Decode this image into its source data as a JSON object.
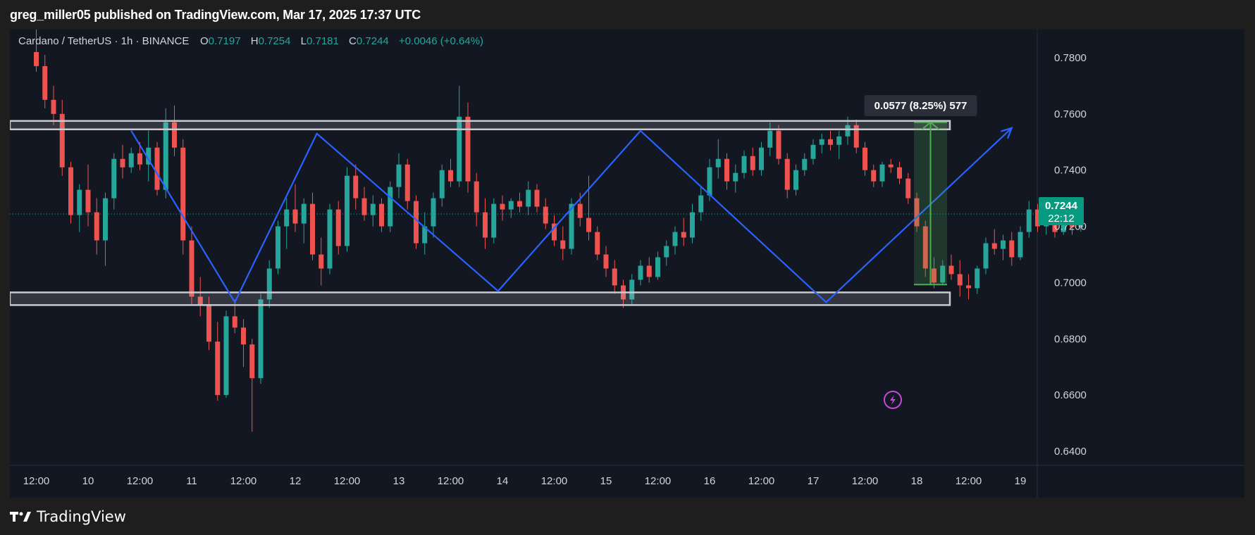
{
  "header": {
    "publisher": "greg_miller05 published on TradingView.com, Mar 17, 2025 17:37 UTC"
  },
  "legend": {
    "symbol": "Cardano / TetherUS · 1h · BINANCE",
    "open_label": "O",
    "open": "0.7197",
    "high_label": "H",
    "high": "0.7254",
    "low_label": "L",
    "low": "0.7181",
    "close_label": "C",
    "close": "0.7244",
    "change": "+0.0046 (+0.64%)"
  },
  "price_badge": {
    "price": "0.7244",
    "countdown": "22:12"
  },
  "measure_label": "0.0577 (8.25%) 577",
  "footer": {
    "brand": "TradingView"
  },
  "colors": {
    "up": "#26a69a",
    "down": "#ef5350",
    "zigzag": "#2962ff",
    "range_box": "#c8cad0",
    "measure": "#4caf50",
    "badge": "#089981"
  },
  "chart_data": {
    "type": "candlestick",
    "ylim": [
      0.635,
      0.79
    ],
    "y_ticks": [
      "0.7800",
      "0.7600",
      "0.7400",
      "0.7200",
      "0.7000",
      "0.6800",
      "0.6600",
      "0.6400"
    ],
    "x_ticks": [
      "12:00",
      "10",
      "12:00",
      "11",
      "12:00",
      "12",
      "12:00",
      "13",
      "12:00",
      "14",
      "12:00",
      "15",
      "12:00",
      "16",
      "12:00",
      "17",
      "12:00",
      "18",
      "12:00",
      "19"
    ],
    "current_price": 0.7244,
    "range_zones": [
      {
        "name": "resistance",
        "low": 0.7545,
        "high": 0.7575
      },
      {
        "name": "support",
        "low": 0.692,
        "high": 0.6965
      }
    ],
    "measure": {
      "from": 0.6993,
      "to": 0.757,
      "change": 0.0577,
      "percent": 8.25
    },
    "zigzag": [
      {
        "t": "Mar 10 10:00",
        "price": 0.754
      },
      {
        "t": "Mar 11 10:00",
        "price": 0.693
      },
      {
        "t": "Mar 12 05:00",
        "price": 0.753
      },
      {
        "t": "Mar 13 23:00",
        "price": 0.697
      },
      {
        "t": "Mar 15 08:00",
        "price": 0.754
      },
      {
        "t": "Mar 17 03:00",
        "price": 0.693
      },
      {
        "t": "Mar 18 22:00",
        "price": 0.755
      }
    ],
    "candles": [
      {
        "t": "Mar 09 12:00",
        "o": 0.782,
        "h": 0.79,
        "l": 0.775,
        "c": 0.777
      },
      {
        "t": "Mar 09 14:00",
        "o": 0.777,
        "h": 0.781,
        "l": 0.762,
        "c": 0.765
      },
      {
        "t": "Mar 09 16:00",
        "o": 0.765,
        "h": 0.77,
        "l": 0.756,
        "c": 0.76
      },
      {
        "t": "Mar 09 18:00",
        "o": 0.76,
        "h": 0.765,
        "l": 0.738,
        "c": 0.741
      },
      {
        "t": "Mar 09 20:00",
        "o": 0.741,
        "h": 0.743,
        "l": 0.721,
        "c": 0.724
      },
      {
        "t": "Mar 09 22:00",
        "o": 0.724,
        "h": 0.735,
        "l": 0.718,
        "c": 0.733
      },
      {
        "t": "Mar 10 00:00",
        "o": 0.733,
        "h": 0.742,
        "l": 0.72,
        "c": 0.725
      },
      {
        "t": "Mar 10 02:00",
        "o": 0.725,
        "h": 0.73,
        "l": 0.71,
        "c": 0.715
      },
      {
        "t": "Mar 10 04:00",
        "o": 0.715,
        "h": 0.732,
        "l": 0.706,
        "c": 0.73
      },
      {
        "t": "Mar 10 06:00",
        "o": 0.73,
        "h": 0.746,
        "l": 0.726,
        "c": 0.744
      },
      {
        "t": "Mar 10 08:00",
        "o": 0.744,
        "h": 0.749,
        "l": 0.737,
        "c": 0.741
      },
      {
        "t": "Mar 10 10:00",
        "o": 0.741,
        "h": 0.748,
        "l": 0.739,
        "c": 0.746
      },
      {
        "t": "Mar 10 12:00",
        "o": 0.746,
        "h": 0.75,
        "l": 0.74,
        "c": 0.742
      },
      {
        "t": "Mar 10 14:00",
        "o": 0.742,
        "h": 0.754,
        "l": 0.736,
        "c": 0.748
      },
      {
        "t": "Mar 10 16:00",
        "o": 0.748,
        "h": 0.75,
        "l": 0.731,
        "c": 0.733
      },
      {
        "t": "Mar 10 18:00",
        "o": 0.733,
        "h": 0.762,
        "l": 0.73,
        "c": 0.757
      },
      {
        "t": "Mar 10 20:00",
        "o": 0.757,
        "h": 0.763,
        "l": 0.745,
        "c": 0.748
      },
      {
        "t": "Mar 10 22:00",
        "o": 0.748,
        "h": 0.751,
        "l": 0.71,
        "c": 0.715
      },
      {
        "t": "Mar 11 00:00",
        "o": 0.715,
        "h": 0.72,
        "l": 0.692,
        "c": 0.695
      },
      {
        "t": "Mar 11 02:00",
        "o": 0.695,
        "h": 0.702,
        "l": 0.688,
        "c": 0.692
      },
      {
        "t": "Mar 11 04:00",
        "o": 0.692,
        "h": 0.695,
        "l": 0.676,
        "c": 0.679
      },
      {
        "t": "Mar 11 06:00",
        "o": 0.679,
        "h": 0.686,
        "l": 0.658,
        "c": 0.66
      },
      {
        "t": "Mar 11 08:00",
        "o": 0.66,
        "h": 0.69,
        "l": 0.659,
        "c": 0.688
      },
      {
        "t": "Mar 11 10:00",
        "o": 0.688,
        "h": 0.694,
        "l": 0.682,
        "c": 0.684
      },
      {
        "t": "Mar 11 12:00",
        "o": 0.684,
        "h": 0.687,
        "l": 0.67,
        "c": 0.678
      },
      {
        "t": "Mar 11 14:00",
        "o": 0.678,
        "h": 0.68,
        "l": 0.647,
        "c": 0.666
      },
      {
        "t": "Mar 11 16:00",
        "o": 0.666,
        "h": 0.696,
        "l": 0.664,
        "c": 0.694
      },
      {
        "t": "Mar 11 18:00",
        "o": 0.694,
        "h": 0.708,
        "l": 0.691,
        "c": 0.705
      },
      {
        "t": "Mar 11 20:00",
        "o": 0.705,
        "h": 0.722,
        "l": 0.703,
        "c": 0.72
      },
      {
        "t": "Mar 11 22:00",
        "o": 0.72,
        "h": 0.73,
        "l": 0.712,
        "c": 0.726
      },
      {
        "t": "Mar 12 00:00",
        "o": 0.726,
        "h": 0.735,
        "l": 0.718,
        "c": 0.721
      },
      {
        "t": "Mar 12 02:00",
        "o": 0.721,
        "h": 0.73,
        "l": 0.714,
        "c": 0.728
      },
      {
        "t": "Mar 12 04:00",
        "o": 0.728,
        "h": 0.732,
        "l": 0.708,
        "c": 0.71
      },
      {
        "t": "Mar 12 06:00",
        "o": 0.71,
        "h": 0.716,
        "l": 0.699,
        "c": 0.705
      },
      {
        "t": "Mar 12 08:00",
        "o": 0.705,
        "h": 0.728,
        "l": 0.703,
        "c": 0.726
      },
      {
        "t": "Mar 12 10:00",
        "o": 0.726,
        "h": 0.729,
        "l": 0.71,
        "c": 0.713
      },
      {
        "t": "Mar 12 12:00",
        "o": 0.713,
        "h": 0.741,
        "l": 0.711,
        "c": 0.738
      },
      {
        "t": "Mar 12 14:00",
        "o": 0.738,
        "h": 0.742,
        "l": 0.726,
        "c": 0.73
      },
      {
        "t": "Mar 12 16:00",
        "o": 0.73,
        "h": 0.734,
        "l": 0.722,
        "c": 0.724
      },
      {
        "t": "Mar 12 18:00",
        "o": 0.724,
        "h": 0.731,
        "l": 0.72,
        "c": 0.728
      },
      {
        "t": "Mar 12 20:00",
        "o": 0.728,
        "h": 0.73,
        "l": 0.718,
        "c": 0.72
      },
      {
        "t": "Mar 12 22:00",
        "o": 0.72,
        "h": 0.736,
        "l": 0.718,
        "c": 0.734
      },
      {
        "t": "Mar 13 00:00",
        "o": 0.734,
        "h": 0.746,
        "l": 0.73,
        "c": 0.742
      },
      {
        "t": "Mar 13 02:00",
        "o": 0.742,
        "h": 0.744,
        "l": 0.726,
        "c": 0.729
      },
      {
        "t": "Mar 13 04:00",
        "o": 0.729,
        "h": 0.731,
        "l": 0.712,
        "c": 0.714
      },
      {
        "t": "Mar 13 06:00",
        "o": 0.714,
        "h": 0.725,
        "l": 0.71,
        "c": 0.72
      },
      {
        "t": "Mar 13 08:00",
        "o": 0.72,
        "h": 0.732,
        "l": 0.716,
        "c": 0.73
      },
      {
        "t": "Mar 13 10:00",
        "o": 0.73,
        "h": 0.742,
        "l": 0.727,
        "c": 0.74
      },
      {
        "t": "Mar 13 12:00",
        "o": 0.74,
        "h": 0.744,
        "l": 0.734,
        "c": 0.736
      },
      {
        "t": "Mar 13 14:00",
        "o": 0.736,
        "h": 0.77,
        "l": 0.734,
        "c": 0.759
      },
      {
        "t": "Mar 13 16:00",
        "o": 0.759,
        "h": 0.764,
        "l": 0.732,
        "c": 0.736
      },
      {
        "t": "Mar 13 18:00",
        "o": 0.736,
        "h": 0.739,
        "l": 0.72,
        "c": 0.725
      },
      {
        "t": "Mar 13 20:00",
        "o": 0.725,
        "h": 0.73,
        "l": 0.712,
        "c": 0.716
      },
      {
        "t": "Mar 13 22:00",
        "o": 0.716,
        "h": 0.73,
        "l": 0.714,
        "c": 0.728
      },
      {
        "t": "Mar 14 00:00",
        "o": 0.728,
        "h": 0.731,
        "l": 0.722,
        "c": 0.726
      },
      {
        "t": "Mar 14 02:00",
        "o": 0.726,
        "h": 0.73,
        "l": 0.723,
        "c": 0.729
      },
      {
        "t": "Mar 14 04:00",
        "o": 0.729,
        "h": 0.732,
        "l": 0.725,
        "c": 0.727
      },
      {
        "t": "Mar 14 06:00",
        "o": 0.727,
        "h": 0.736,
        "l": 0.724,
        "c": 0.733
      },
      {
        "t": "Mar 14 08:00",
        "o": 0.733,
        "h": 0.735,
        "l": 0.725,
        "c": 0.727
      },
      {
        "t": "Mar 14 10:00",
        "o": 0.727,
        "h": 0.73,
        "l": 0.719,
        "c": 0.721
      },
      {
        "t": "Mar 14 12:00",
        "o": 0.721,
        "h": 0.724,
        "l": 0.713,
        "c": 0.715
      },
      {
        "t": "Mar 14 14:00",
        "o": 0.715,
        "h": 0.72,
        "l": 0.708,
        "c": 0.712
      },
      {
        "t": "Mar 14 16:00",
        "o": 0.712,
        "h": 0.73,
        "l": 0.71,
        "c": 0.728
      },
      {
        "t": "Mar 14 18:00",
        "o": 0.728,
        "h": 0.732,
        "l": 0.72,
        "c": 0.723
      },
      {
        "t": "Mar 14 20:00",
        "o": 0.723,
        "h": 0.738,
        "l": 0.715,
        "c": 0.718
      },
      {
        "t": "Mar 14 22:00",
        "o": 0.718,
        "h": 0.72,
        "l": 0.708,
        "c": 0.71
      },
      {
        "t": "Mar 15 00:00",
        "o": 0.71,
        "h": 0.713,
        "l": 0.702,
        "c": 0.705
      },
      {
        "t": "Mar 15 02:00",
        "o": 0.705,
        "h": 0.708,
        "l": 0.696,
        "c": 0.699
      },
      {
        "t": "Mar 15 04:00",
        "o": 0.699,
        "h": 0.701,
        "l": 0.691,
        "c": 0.694
      },
      {
        "t": "Mar 15 06:00",
        "o": 0.694,
        "h": 0.703,
        "l": 0.692,
        "c": 0.701
      },
      {
        "t": "Mar 15 08:00",
        "o": 0.701,
        "h": 0.708,
        "l": 0.699,
        "c": 0.706
      },
      {
        "t": "Mar 15 10:00",
        "o": 0.706,
        "h": 0.709,
        "l": 0.7,
        "c": 0.702
      },
      {
        "t": "Mar 15 12:00",
        "o": 0.702,
        "h": 0.711,
        "l": 0.701,
        "c": 0.709
      },
      {
        "t": "Mar 15 14:00",
        "o": 0.709,
        "h": 0.715,
        "l": 0.706,
        "c": 0.713
      },
      {
        "t": "Mar 15 16:00",
        "o": 0.713,
        "h": 0.72,
        "l": 0.71,
        "c": 0.718
      },
      {
        "t": "Mar 15 18:00",
        "o": 0.718,
        "h": 0.723,
        "l": 0.713,
        "c": 0.716
      },
      {
        "t": "Mar 15 20:00",
        "o": 0.716,
        "h": 0.728,
        "l": 0.714,
        "c": 0.725
      },
      {
        "t": "Mar 15 22:00",
        "o": 0.725,
        "h": 0.734,
        "l": 0.722,
        "c": 0.731
      },
      {
        "t": "Mar 16 00:00",
        "o": 0.731,
        "h": 0.744,
        "l": 0.729,
        "c": 0.741
      },
      {
        "t": "Mar 16 02:00",
        "o": 0.741,
        "h": 0.751,
        "l": 0.737,
        "c": 0.744
      },
      {
        "t": "Mar 16 04:00",
        "o": 0.744,
        "h": 0.746,
        "l": 0.733,
        "c": 0.736
      },
      {
        "t": "Mar 16 06:00",
        "o": 0.736,
        "h": 0.742,
        "l": 0.732,
        "c": 0.739
      },
      {
        "t": "Mar 16 08:00",
        "o": 0.739,
        "h": 0.747,
        "l": 0.737,
        "c": 0.745
      },
      {
        "t": "Mar 16 10:00",
        "o": 0.745,
        "h": 0.748,
        "l": 0.738,
        "c": 0.74
      },
      {
        "t": "Mar 16 12:00",
        "o": 0.74,
        "h": 0.75,
        "l": 0.738,
        "c": 0.748
      },
      {
        "t": "Mar 16 14:00",
        "o": 0.748,
        "h": 0.757,
        "l": 0.745,
        "c": 0.754
      },
      {
        "t": "Mar 16 16:00",
        "o": 0.754,
        "h": 0.756,
        "l": 0.742,
        "c": 0.744
      },
      {
        "t": "Mar 16 18:00",
        "o": 0.744,
        "h": 0.746,
        "l": 0.73,
        "c": 0.733
      },
      {
        "t": "Mar 16 20:00",
        "o": 0.733,
        "h": 0.742,
        "l": 0.731,
        "c": 0.74
      },
      {
        "t": "Mar 16 22:00",
        "o": 0.74,
        "h": 0.746,
        "l": 0.738,
        "c": 0.744
      },
      {
        "t": "Mar 17 00:00",
        "o": 0.744,
        "h": 0.751,
        "l": 0.742,
        "c": 0.749
      },
      {
        "t": "Mar 17 02:00",
        "o": 0.749,
        "h": 0.753,
        "l": 0.746,
        "c": 0.751
      },
      {
        "t": "Mar 17 04:00",
        "o": 0.751,
        "h": 0.754,
        "l": 0.747,
        "c": 0.749
      },
      {
        "t": "Mar 17 06:00",
        "o": 0.749,
        "h": 0.754,
        "l": 0.744,
        "c": 0.752
      },
      {
        "t": "Mar 17 08:00",
        "o": 0.752,
        "h": 0.759,
        "l": 0.749,
        "c": 0.756
      },
      {
        "t": "Mar 17 10:00",
        "o": 0.756,
        "h": 0.758,
        "l": 0.746,
        "c": 0.748
      },
      {
        "t": "Mar 17 12:00",
        "o": 0.748,
        "h": 0.75,
        "l": 0.738,
        "c": 0.74
      },
      {
        "t": "Mar 17 14:00",
        "o": 0.74,
        "h": 0.742,
        "l": 0.734,
        "c": 0.736
      },
      {
        "t": "Mar 17 16:00",
        "o": 0.736,
        "h": 0.743,
        "l": 0.734,
        "c": 0.742
      },
      {
        "t": "Mar 17 18:00",
        "o": 0.742,
        "h": 0.744,
        "l": 0.739,
        "c": 0.741
      },
      {
        "t": "Mar 17 20:00",
        "o": 0.741,
        "h": 0.743,
        "l": 0.735,
        "c": 0.737
      },
      {
        "t": "Mar 17 22:00",
        "o": 0.737,
        "h": 0.739,
        "l": 0.728,
        "c": 0.73
      },
      {
        "t": "Mar 18 00:00",
        "o": 0.73,
        "h": 0.732,
        "l": 0.718,
        "c": 0.72
      },
      {
        "t": "Mar 18 02:00",
        "o": 0.72,
        "h": 0.722,
        "l": 0.702,
        "c": 0.705
      },
      {
        "t": "Mar 18 04:00",
        "o": 0.705,
        "h": 0.709,
        "l": 0.698,
        "c": 0.7
      },
      {
        "t": "Mar 18 06:00",
        "o": 0.7,
        "h": 0.708,
        "l": 0.699,
        "c": 0.706
      },
      {
        "t": "Mar 18 08:00",
        "o": 0.706,
        "h": 0.71,
        "l": 0.701,
        "c": 0.703
      },
      {
        "t": "Mar 18 10:00",
        "o": 0.703,
        "h": 0.708,
        "l": 0.695,
        "c": 0.699
      },
      {
        "t": "Mar 18 12:00",
        "o": 0.699,
        "h": 0.703,
        "l": 0.694,
        "c": 0.698
      },
      {
        "t": "Mar 18 14:00",
        "o": 0.698,
        "h": 0.706,
        "l": 0.696,
        "c": 0.705
      },
      {
        "t": "Mar 18 16:00",
        "o": 0.705,
        "h": 0.716,
        "l": 0.703,
        "c": 0.714
      },
      {
        "t": "Mar 18 18:00",
        "o": 0.714,
        "h": 0.719,
        "l": 0.71,
        "c": 0.712
      },
      {
        "t": "Mar 18 20:00",
        "o": 0.712,
        "h": 0.717,
        "l": 0.708,
        "c": 0.715
      },
      {
        "t": "Mar 18 22:00",
        "o": 0.715,
        "h": 0.718,
        "l": 0.706,
        "c": 0.709
      },
      {
        "t": "Mar 19 00:00",
        "o": 0.709,
        "h": 0.72,
        "l": 0.708,
        "c": 0.718
      },
      {
        "t": "Mar 19 02:00",
        "o": 0.718,
        "h": 0.729,
        "l": 0.716,
        "c": 0.726
      },
      {
        "t": "Mar 19 04:00",
        "o": 0.726,
        "h": 0.728,
        "l": 0.718,
        "c": 0.72
      },
      {
        "t": "Mar 19 06:00",
        "o": 0.72,
        "h": 0.726,
        "l": 0.717,
        "c": 0.724
      },
      {
        "t": "Mar 19 08:00",
        "o": 0.724,
        "h": 0.73,
        "l": 0.716,
        "c": 0.718
      },
      {
        "t": "Mar 19 10:00",
        "o": 0.718,
        "h": 0.727,
        "l": 0.717,
        "c": 0.725
      },
      {
        "t": "Mar 19 12:00",
        "o": 0.725,
        "h": 0.726,
        "l": 0.717,
        "c": 0.7197
      },
      {
        "t": "Mar 19 14:00",
        "o": 0.7197,
        "h": 0.7254,
        "l": 0.7181,
        "c": 0.7244
      }
    ]
  }
}
